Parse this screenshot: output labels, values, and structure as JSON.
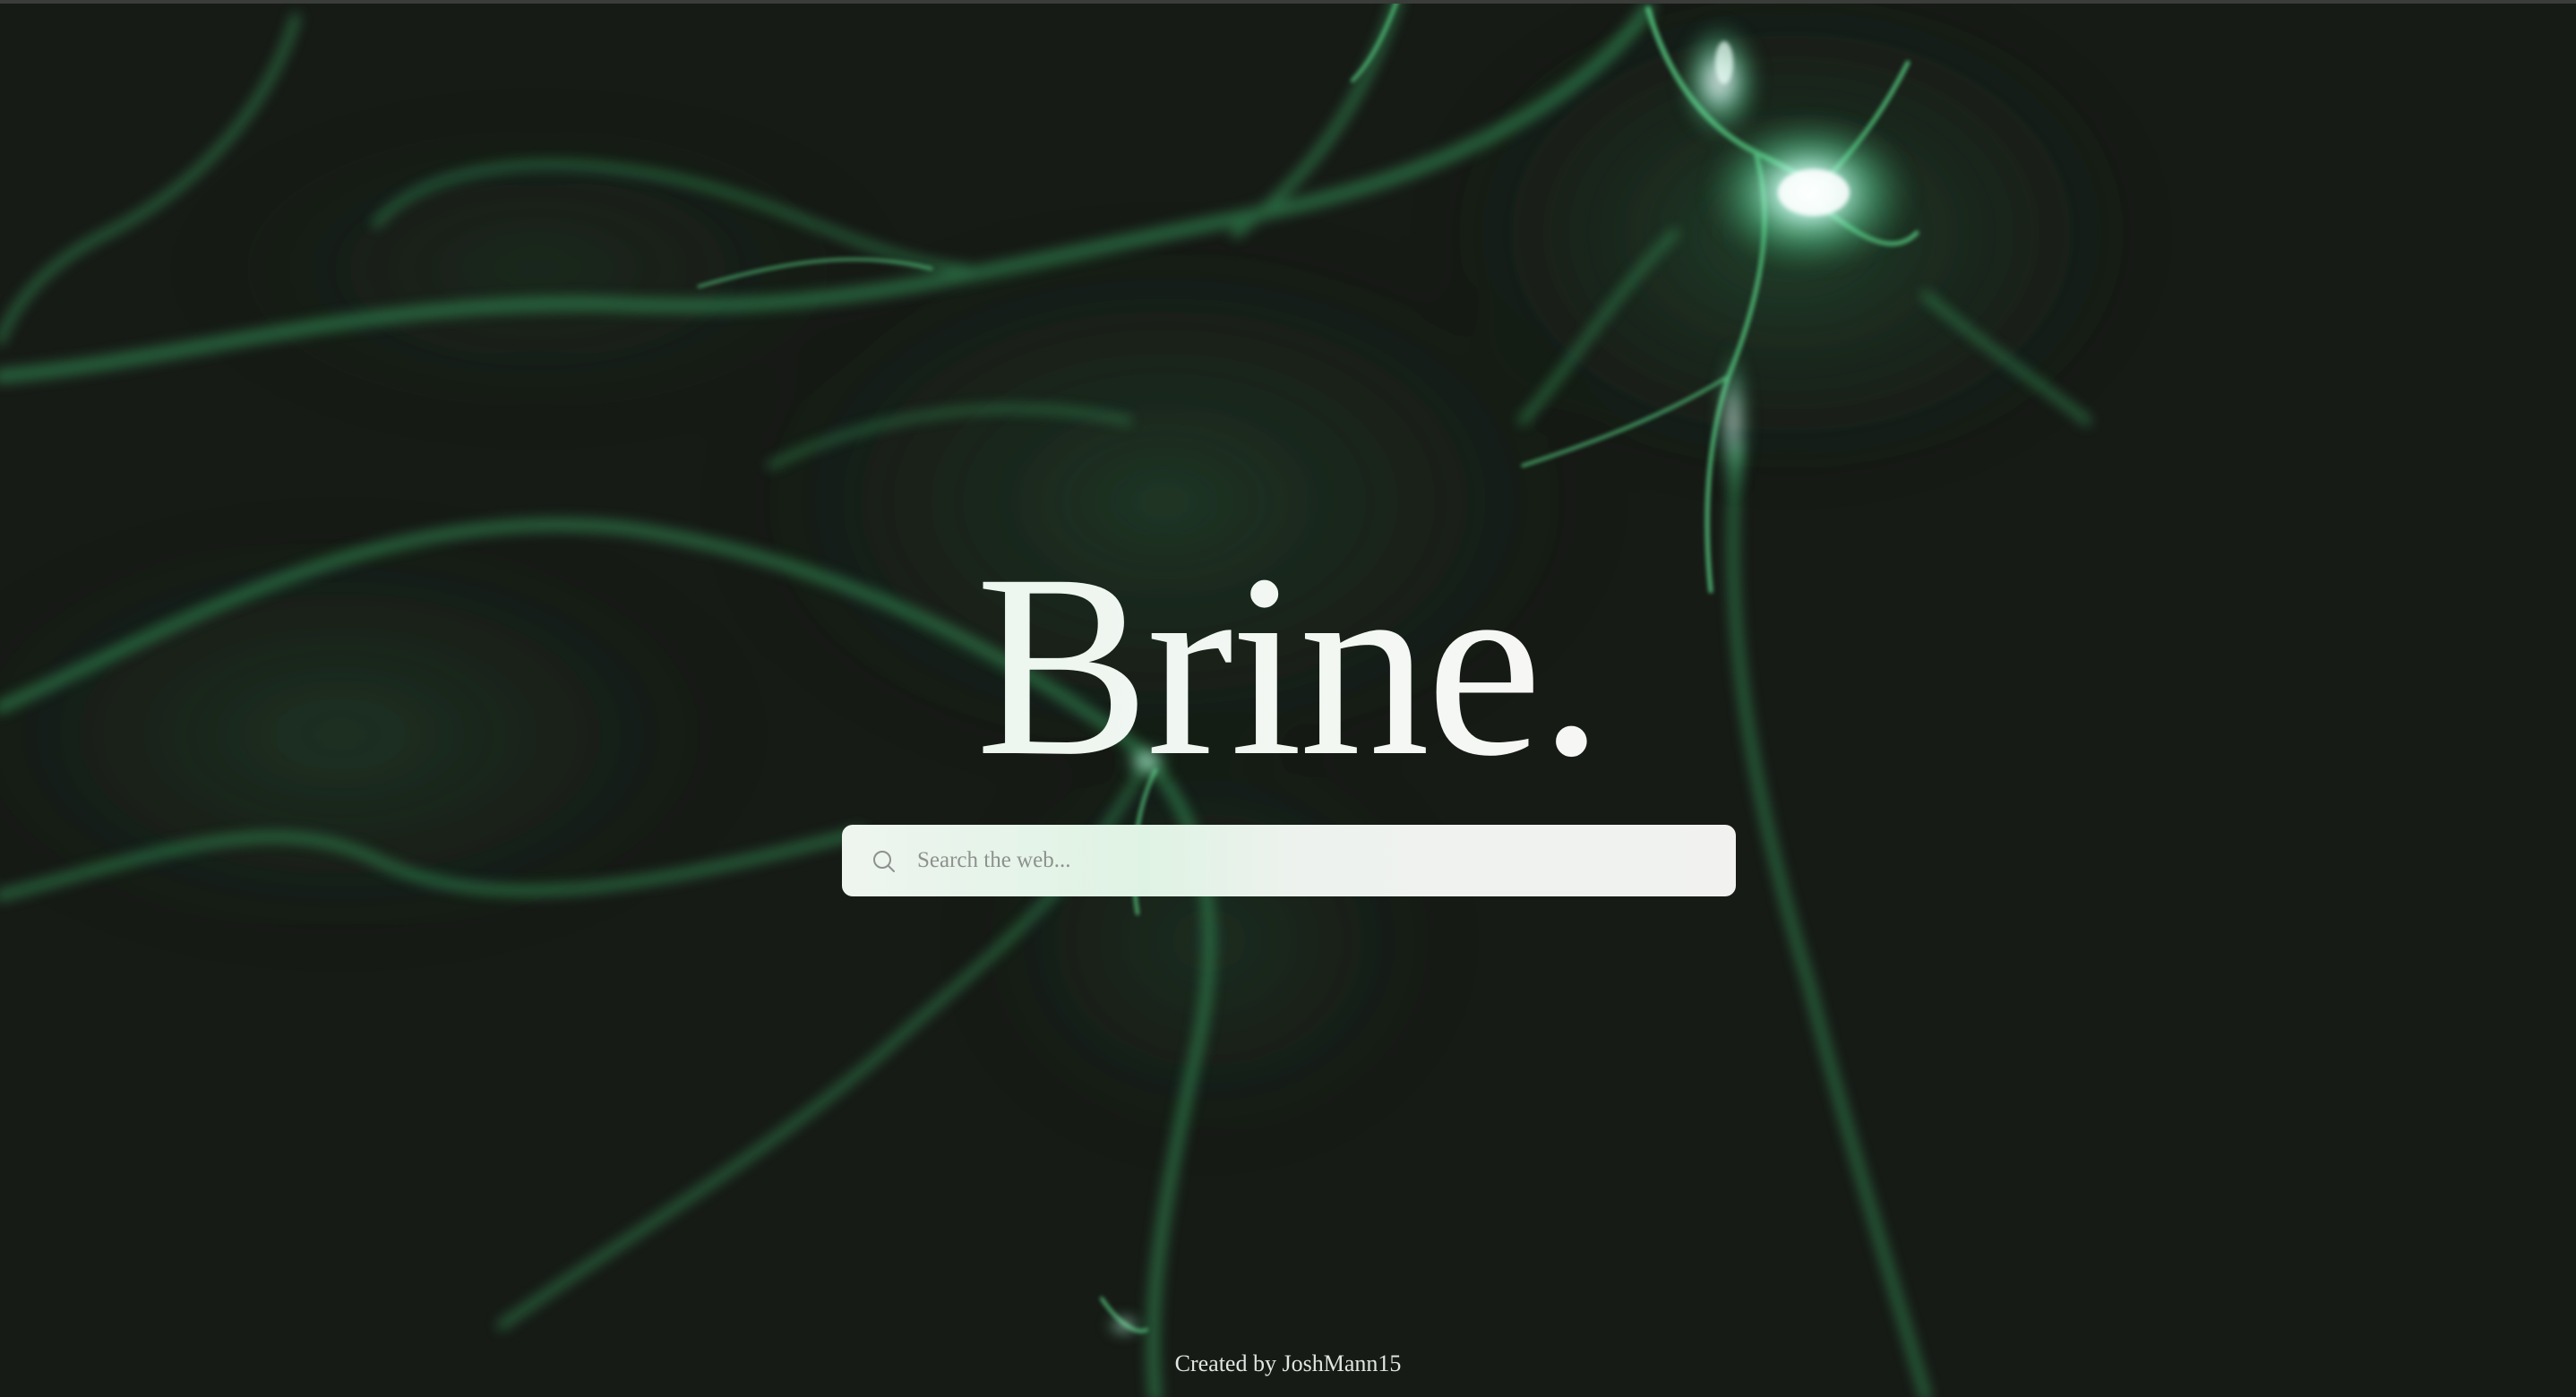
{
  "app": {
    "title": "Brine."
  },
  "search": {
    "placeholder": "Search the web...",
    "value": "",
    "icon": "search-icon"
  },
  "footer": {
    "credit": "Created by JoshMann15"
  },
  "colors": {
    "background": "#171b16",
    "glow_green": "#3fa866",
    "glow_highlight": "#c8fff0",
    "title_text": "#f4f6f2",
    "search_bg": "#f1f2f0"
  }
}
